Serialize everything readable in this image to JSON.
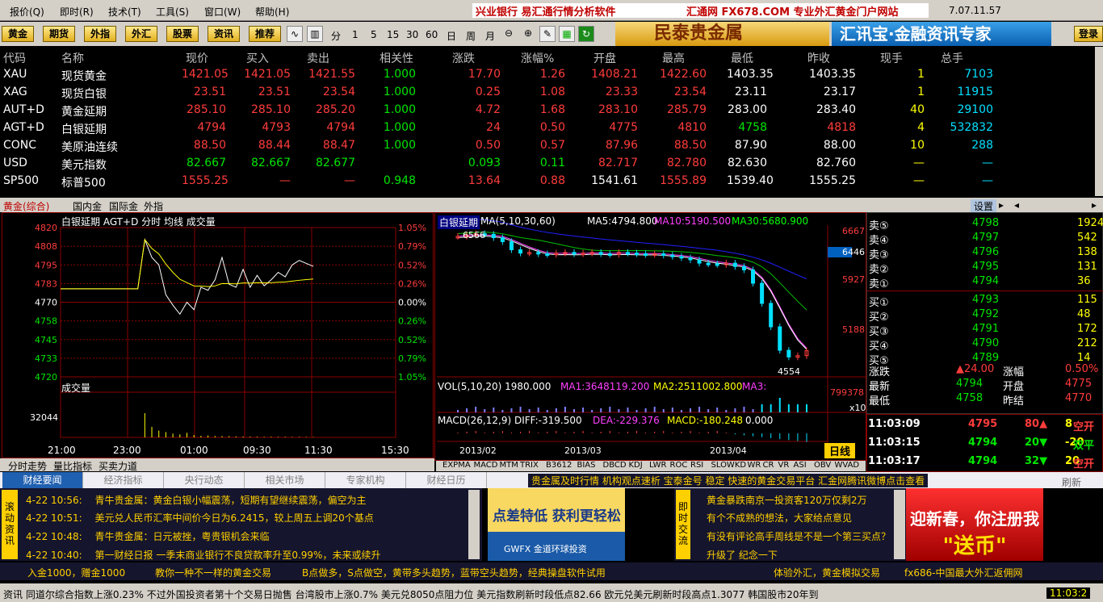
{
  "menu": [
    "报价(Q)",
    "即时(R)",
    "技术(T)",
    "工具(S)",
    "窗口(W)",
    "帮助(H)"
  ],
  "brand_text": "兴业银行 易汇通行情分析软件",
  "brand2_text": "汇通网 FX678.COM 专业外汇黄金门户网站",
  "version": "7.07.11.57",
  "toolbar_buttons": [
    "黄金",
    "期货",
    "外指",
    "外汇",
    "股票",
    "资讯",
    "推荐"
  ],
  "periods": [
    "分",
    "1",
    "5",
    "15",
    "30",
    "60",
    "日",
    "周",
    "月"
  ],
  "banner1": "民泰贵金属",
  "banner2": "汇讯宝·金融资讯专家",
  "login_label": "登录",
  "quote_headers": [
    "代码",
    "名称",
    "现价",
    "买入",
    "卖出",
    "相关性",
    "涨跌",
    "涨幅%",
    "开盘",
    "最高",
    "最低",
    "昨收",
    "现手",
    "总手"
  ],
  "quotes": [
    [
      "XAU",
      "现货黄金",
      "1421.05",
      "1421.05",
      "1421.55",
      "1.000",
      "17.70",
      "1.26",
      "1408.21",
      "1422.60",
      "1403.35",
      "1403.35",
      "1",
      "7103"
    ],
    [
      "XAG",
      "现货白银",
      "23.51",
      "23.51",
      "23.54",
      "1.000",
      "0.25",
      "1.08",
      "23.33",
      "23.54",
      "23.11",
      "23.17",
      "1",
      "11915"
    ],
    [
      "AUT+D",
      "黄金延期",
      "285.10",
      "285.10",
      "285.20",
      "1.000",
      "4.72",
      "1.68",
      "283.10",
      "285.79",
      "283.00",
      "283.40",
      "40",
      "29100"
    ],
    [
      "AGT+D",
      "白银延期",
      "4794",
      "4793",
      "4794",
      "1.000",
      "24",
      "0.50",
      "4775",
      "4810",
      "4758",
      "4818",
      "4",
      "532832"
    ],
    [
      "CONC",
      "美原油连续",
      "88.50",
      "88.44",
      "88.47",
      "1.000",
      "0.50",
      "0.57",
      "87.96",
      "88.50",
      "87.90",
      "88.00",
      "10",
      "288"
    ],
    [
      "USD",
      "美元指数",
      "82.667",
      "82.667",
      "82.677",
      "",
      "0.093",
      "0.11",
      "82.717",
      "82.780",
      "82.630",
      "82.760",
      "—",
      "—"
    ],
    [
      "SP500",
      "标普500",
      "1555.25",
      "—",
      "—",
      "0.948",
      "13.64",
      "0.88",
      "1541.61",
      "1555.89",
      "1539.40",
      "1555.25",
      "—",
      "—"
    ]
  ],
  "sheet_tabs": [
    "黄金(综合)",
    "国内金",
    "国际金",
    "外指"
  ],
  "settings_label": "设置",
  "intraday": {
    "title": "白银延期 AGT+D 分时 均线 成交量",
    "prices": [
      "4820",
      "4808",
      "4795",
      "4783",
      "4770",
      "4758",
      "4745",
      "4733",
      "4720"
    ],
    "pcts": [
      "1.05%",
      "0.79%",
      "0.52%",
      "0.26%",
      "0.00%",
      "0.26%",
      "0.52%",
      "0.79%",
      "1.05%"
    ],
    "volume_label": "成交量",
    "volume_tick": "32044",
    "times": [
      "21:00",
      "23:00",
      "01:00",
      "09:30",
      "11:30",
      "15:30"
    ],
    "price_series": [
      4779,
      4779,
      4779,
      4779,
      4779,
      4779,
      4779,
      4779,
      4779,
      4779,
      4779,
      4779,
      4812,
      4800,
      4795,
      4775,
      4768,
      4762,
      4770,
      4765,
      4780,
      4778,
      4785,
      4800,
      4782,
      4780,
      4792,
      4780,
      4788,
      4781,
      4785,
      4790,
      4787,
      4795,
      4798,
      4796,
      4794
    ],
    "volume_series": [
      0,
      0,
      0,
      0,
      0,
      0,
      0,
      0,
      0,
      0,
      0,
      0,
      32044,
      14000,
      9000,
      7000,
      5000,
      4000,
      6000,
      3000,
      2000,
      2500,
      1800,
      1600,
      1500,
      1200,
      1100,
      1000,
      900,
      800,
      900,
      700,
      800,
      600,
      700,
      600,
      500
    ]
  },
  "kline": {
    "title": "白银延期",
    "ma_label": "MA(5,10,30,60)",
    "ma5": "MA5:4794.800",
    "ma10": "MA10:5190.500",
    "ma30": "MA30:5680.900",
    "high_label": "6566",
    "low_label": "4554",
    "yticks": [
      "6667",
      "6446",
      "5927",
      "5188"
    ],
    "vol_label": "VOL(5,10,20) 1980.000",
    "vma1": "MA1:3648119.200",
    "vma2": "MA2:2511002.800",
    "vma3": "MA3:",
    "vol_tick": "799378",
    "vol_mult": "x10",
    "macd_label": "MACD(26,12,9) DIFF:-319.500",
    "dea": "DEA:-229.376",
    "macd": "MACD:-180.248",
    "macd_zero": "0.000",
    "dates": [
      "2013/02",
      "2013/03",
      "2013/04"
    ],
    "day_label": "日线",
    "closes": [
      6500,
      6520,
      6540,
      6530,
      6480,
      6420,
      6300,
      6250,
      6260,
      6240,
      6230,
      6250,
      6260,
      6240,
      6250,
      6260,
      6240,
      6230,
      6260,
      6250,
      6240,
      6230,
      6240,
      6220,
      6200,
      6180,
      6150,
      6100,
      6090,
      6080,
      6100,
      6050,
      6000,
      5800,
      5500,
      5150,
      4800,
      4700,
      4720,
      4794
    ]
  },
  "order_book": {
    "sell": [
      [
        "卖⑤",
        "4798",
        "1924"
      ],
      [
        "卖④",
        "4797",
        "542"
      ],
      [
        "卖③",
        "4796",
        "138"
      ],
      [
        "卖②",
        "4795",
        "131"
      ],
      [
        "卖①",
        "4794",
        "36"
      ]
    ],
    "buy": [
      [
        "买①",
        "4793",
        "115"
      ],
      [
        "买②",
        "4792",
        "48"
      ],
      [
        "买③",
        "4791",
        "172"
      ],
      [
        "买④",
        "4790",
        "212"
      ],
      [
        "买⑤",
        "4789",
        "14"
      ]
    ],
    "stats": [
      [
        "涨跌",
        "▲24.00",
        "涨幅",
        "0.50%"
      ],
      [
        "最新",
        "4794",
        "开盘",
        "4775"
      ],
      [
        "最低",
        "4758",
        "昨结",
        "4770"
      ]
    ]
  },
  "ticks": [
    [
      "11:03:09",
      "4795",
      "80▲",
      "8",
      "空开"
    ],
    [
      "11:03:15",
      "4794",
      "20▼",
      "-20",
      "双平"
    ],
    [
      "11:03:17",
      "4794",
      "32▼",
      "20",
      "空开"
    ]
  ],
  "bottom_tabs": [
    "分时走势",
    "量比指标",
    "买卖力道"
  ],
  "indicator_tabs": [
    "EXPMA",
    "MACD",
    "MTM",
    "TRIX",
    "B3612",
    "BIAS",
    "DBCD",
    "KDJ",
    "LWR",
    "ROC",
    "RSI",
    "SLOWKD",
    "WR",
    "CR",
    "VR",
    "ASI",
    "OBV",
    "WVAD"
  ],
  "news_tabs": [
    "财经要闻",
    "经济指标",
    "央行动态",
    "相关市场",
    "专家机构",
    "财经日历"
  ],
  "news_links": "贵金属及时行情  机构观点速析      宝泰金号 稳定 快速的黄金交易平台      汇金网腾讯微博点击查看",
  "refresh_label": "刷新",
  "news": [
    [
      "4-22 10:56:",
      "青牛贵金属：黄金白银小幅震荡，短期有望继续震荡，偏空为主"
    ],
    [
      "4-22 10:51:",
      "美元兑人民币汇率中间价今日为6.2415，较上周五上调20个基点"
    ],
    [
      "4-22 10:48:",
      "青牛贵金属：日元被挫，粤贵银机会来临"
    ],
    [
      "4-22 10:40:",
      "第一财经日报 一季末商业银行不良贷款率升至0.99%，未来或续升"
    ]
  ],
  "scroll_label": "滚动资讯",
  "banner_ad1": "点差特低 获利更轻松",
  "banner_ad1b": "GWFX 金道环球投资",
  "chat_label": "即时交流",
  "chat": [
    "黄金暴跌南京一投资客120万仅剩2万",
    "有个不成熟的想法，大家给点意见",
    "有没有评论高手周线是不是一个第三买点？",
    "升级了 纪念一下"
  ],
  "banner_ad2": "迎新春，你注册我",
  "banner_ad2b": "\"送币\"",
  "ads": [
    "入金1000，赠金1000",
    "教你一种不一样的黄金交易",
    "B点做多，S点做空，黄带多头趋势，蓝带空头趋势，经典操盘软件试用",
    "体验外汇，黄金模拟交易",
    "fx686-中国最大外汇返佣网"
  ],
  "ticker": "资讯  同道尔综合指数上涨0.23%  不过外国投资者第十个交易日抛售  台湾股市上涨0.7%  美元兑8050点阻力位  美元指数刷新时段低点82.66  欧元兑美元刷新时段高点1.3077  韩国股市20年到",
  "clock": "11:03:2"
}
